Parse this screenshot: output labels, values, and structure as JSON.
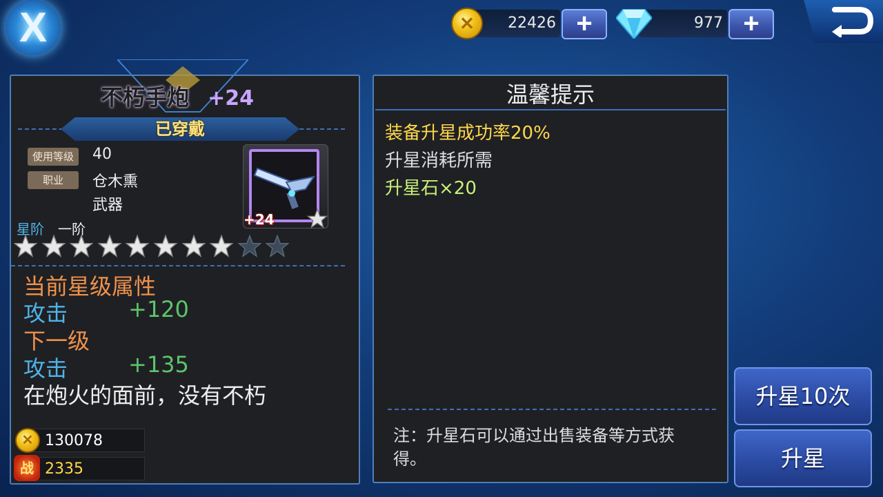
{
  "topbar": {
    "gold_value": "22426",
    "diamond_value": "977",
    "plus_label": "+",
    "logo_glyph": "X"
  },
  "equipment": {
    "name": "不朽手炮",
    "enhance_level": "+24",
    "status": "已穿戴",
    "use_level_label": "使用等级",
    "use_level_value": "40",
    "class_label": "职业",
    "class_value": "仓木熏",
    "type_value": "武器",
    "icon_badge": "+24",
    "star_rank_label": "星阶",
    "star_rank_value": "一阶",
    "stars_filled": 8,
    "stars_total": 10
  },
  "attributes": {
    "current_title": "当前星级属性",
    "current_stat_label": "攻击",
    "current_stat_value": "+120",
    "next_title": "下一级",
    "next_stat_label": "攻击",
    "next_stat_value": "+135",
    "flavor_text": "在炮火的面前，没有不朽"
  },
  "bottom_stats": {
    "gold_value": "130078",
    "power_icon_glyph": "战",
    "power_value": "2335"
  },
  "tips": {
    "title": "温馨提示",
    "success_rate": "装备升星成功率20%",
    "cost_label": "升星消耗所需",
    "cost_item": "升星石×20",
    "note": "注：升星石可以通过出售装备等方式获得。"
  },
  "buttons": {
    "upgrade_10": "升星10次",
    "upgrade": "升星"
  },
  "colors": {
    "panel_bg": "#1f2024",
    "panel_border": "#4f7fb8",
    "orange": "#f0924a",
    "blue": "#4fb4e8",
    "green": "#5cc66a",
    "yellow": "#ffd84a",
    "light_green": "#c9f07a"
  }
}
